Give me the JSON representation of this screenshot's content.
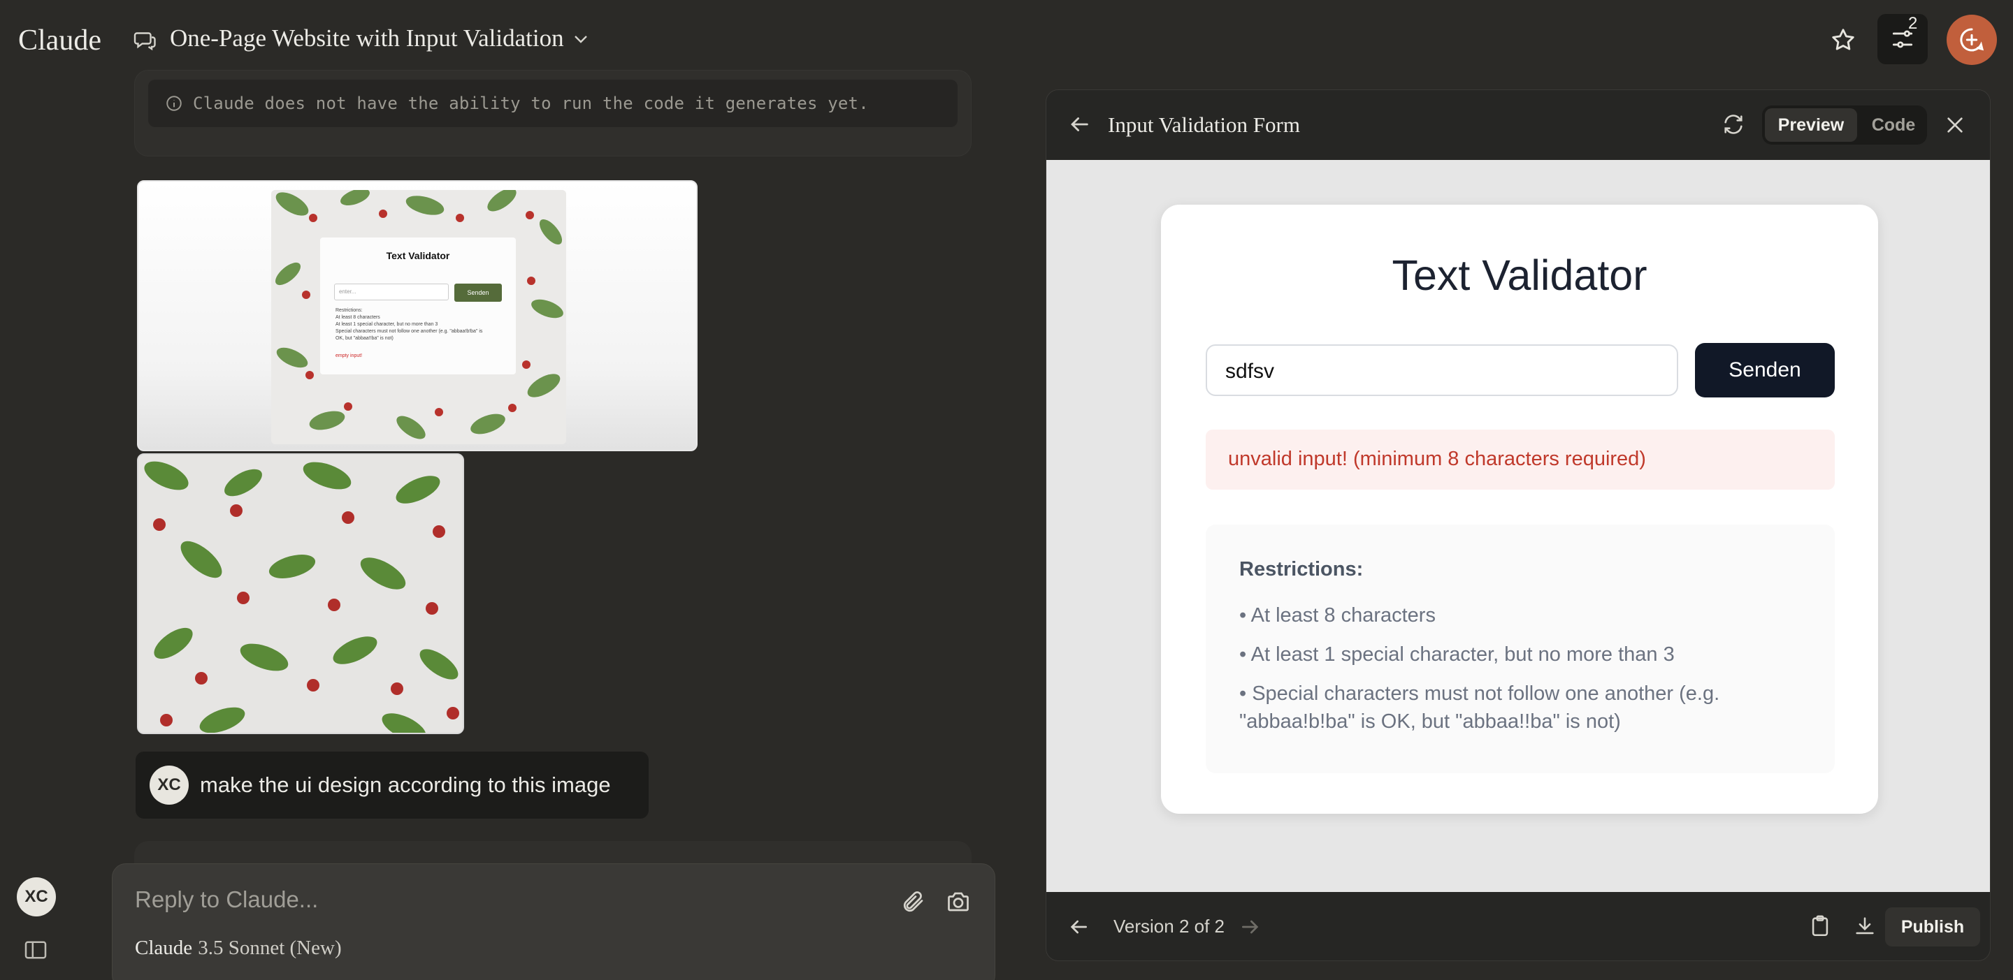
{
  "app": {
    "logo": "Claude"
  },
  "header": {
    "conversation_title": "One-Page Website with Input Validation",
    "badge_count": "2"
  },
  "notice": {
    "text": "Claude does not have the ability to run the code it generates yet."
  },
  "attachments": {
    "screenshot": {
      "title": "Text Validator",
      "input_placeholder": "enter...",
      "button_label": "Senden",
      "restrictions_heading": "Restrictions:",
      "restrictions": [
        "At least 8 characters",
        "At least 1 special character, but no more than 3",
        "Special characters must not follow one another (e.g. \"abbaa!b!ba\" is",
        "OK, but \"abbaa!!ba\" is not)"
      ],
      "error": "empty input!"
    }
  },
  "user_message": {
    "initials": "XC",
    "text": "make the ui design according to this image"
  },
  "composer": {
    "placeholder": "Reply to Claude...",
    "model_brand": "Claude",
    "model_name": "3.5 Sonnet (New)"
  },
  "sidebar": {
    "user_initials": "XC"
  },
  "artifact": {
    "title": "Input Validation Form",
    "tabs": {
      "preview": "Preview",
      "code": "Code"
    },
    "form": {
      "title": "Text Validator",
      "input_value": "sdfsv",
      "button_label": "Senden",
      "error": "unvalid input! (minimum 8 characters required)",
      "restrictions_heading": "Restrictions:",
      "restrictions": [
        "• At least 8 characters",
        "• At least 1 special character, but no more than 3",
        "• Special characters must not follow one another (e.g. \"abbaa!b!ba\" is OK, but \"abbaa!!ba\" is not)"
      ]
    },
    "footer": {
      "version": "Version 2 of 2",
      "publish": "Publish"
    }
  },
  "colors": {
    "background": "#2b2a27",
    "accent_avatar": "#c15f3c",
    "submit_button": "#111827",
    "error_text": "#c0392b",
    "error_bg": "#fdf0ef"
  }
}
